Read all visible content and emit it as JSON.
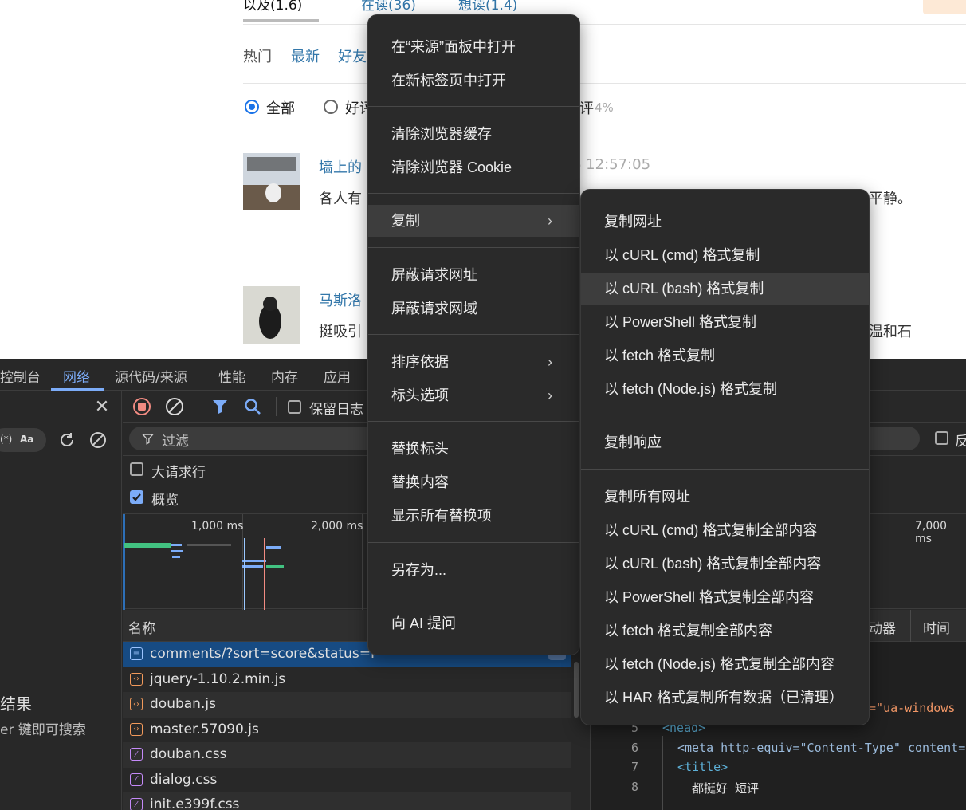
{
  "page": {
    "top_tabs": [
      "以及(1.6)",
      "在读(36)",
      "想读(1.4)"
    ],
    "sort": [
      "热门",
      "最新",
      "好友"
    ],
    "filters": [
      "全部",
      "好评"
    ],
    "filter_tail": "评",
    "filter_percent": "4%",
    "comments": [
      {
        "user": "墙上的",
        "time_partial": "6 12:57:05",
        "text": "各人有",
        "text_tail": "平静。"
      },
      {
        "user": "马斯洛",
        "text": "挺吸引",
        "text_tail": "温和石"
      }
    ]
  },
  "devtools": {
    "tabs": [
      "控制台",
      "网络",
      "源代码/来源",
      "性能",
      "内存",
      "应用"
    ],
    "active_tab": "网络",
    "preserve_log": "保留日志",
    "filter_placeholder": "过滤",
    "big_rows": "大请求行",
    "overview": "概览",
    "timeline_ticks": [
      "1,000 ms",
      "2,000 ms",
      "7,000 ms"
    ],
    "col_name": "名称",
    "col_initiator": "动器",
    "col_time": "时间",
    "search_text_case": "Aa",
    "search_regex": "(*)",
    "left_results": "结果",
    "left_hint": "er 键即可搜索",
    "right_checkbox": "反",
    "requests": [
      {
        "name": "comments/?sort=score&status=I",
        "type": "doc"
      },
      {
        "name": "jquery-1.10.2.min.js",
        "type": "js"
      },
      {
        "name": "douban.js",
        "type": "js"
      },
      {
        "name": "master.57090.js",
        "type": "js"
      },
      {
        "name": "douban.css",
        "type": "css"
      },
      {
        "name": "dialog.css",
        "type": "css"
      },
      {
        "name": "init.e399f.css",
        "type": "css"
      }
    ],
    "code": {
      "line4_tail": "s=\"ua-windows",
      "lines": [
        {
          "n": "5",
          "text": "<head>"
        },
        {
          "n": "6",
          "text": "<meta http-equiv=\"Content-Type\" content=\""
        },
        {
          "n": "7",
          "text": "<title>"
        },
        {
          "n": "8",
          "text": "都挺好 短评"
        }
      ]
    }
  },
  "context_menu": {
    "items": [
      "在“来源”面板中打开",
      "在新标签页中打开",
      "清除浏览器缓存",
      "清除浏览器 Cookie",
      "复制",
      "屏蔽请求网址",
      "屏蔽请求网域",
      "排序依据",
      "标头选项",
      "替换标头",
      "替换内容",
      "显示所有替换项",
      "另存为...",
      "向 AI 提问"
    ],
    "arrow": "›"
  },
  "copy_submenu": {
    "items": [
      "复制网址",
      "以 cURL (cmd) 格式复制",
      "以 cURL (bash) 格式复制",
      "以 PowerShell 格式复制",
      "以 fetch 格式复制",
      "以 fetch (Node.js) 格式复制",
      "复制响应",
      "复制所有网址",
      "以 cURL (cmd) 格式复制全部内容",
      "以 cURL (bash) 格式复制全部内容",
      "以 PowerShell 格式复制全部内容",
      "以 fetch 格式复制全部内容",
      "以 fetch (Node.js) 格式复制全部内容",
      "以 HAR 格式复制所有数据（已清理）"
    ]
  },
  "colors": {
    "accent": "#7cacf8",
    "link": "#3377aa",
    "selected_row": "#174b83",
    "record_red": "#f28b82"
  }
}
